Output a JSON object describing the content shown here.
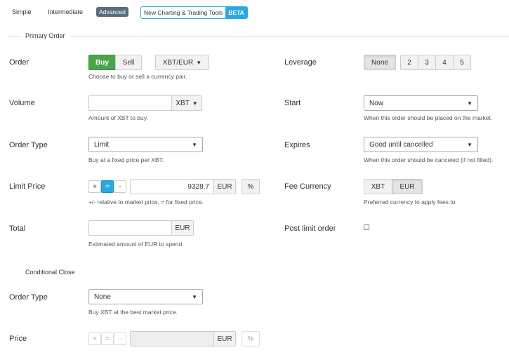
{
  "modes": {
    "simple": "Simple",
    "intermediate": "Intermediate",
    "advanced": "Advanced",
    "new_tools": "New Charting & Trading Tools",
    "beta": "BETA"
  },
  "sections": {
    "primary": "Primary Order",
    "conditional": "Conditional Close"
  },
  "order": {
    "label": "Order",
    "buy": "Buy",
    "sell": "Sell",
    "pair": "XBT/EUR",
    "help": "Choose to buy or sell a currency pair."
  },
  "volume": {
    "label": "Volume",
    "value": "",
    "unit": "XBT",
    "help": "Amount of XBT to buy."
  },
  "order_type": {
    "label": "Order Type",
    "value": "Limit",
    "help": "Buy at a fixed price per XBT."
  },
  "limit_price": {
    "label": "Limit Price",
    "plus": "+",
    "equals": "=",
    "minus": "-",
    "value": "9328.7",
    "unit": "EUR",
    "percent": "%",
    "help": "+/- relative to market price, = for fixed price."
  },
  "total": {
    "label": "Total",
    "value": "",
    "unit": "EUR",
    "help": "Estimated amount of EUR to spend."
  },
  "leverage": {
    "label": "Leverage",
    "options": [
      "None",
      "2",
      "3",
      "4",
      "5"
    ],
    "selected": "None"
  },
  "start": {
    "label": "Start",
    "value": "Now",
    "help": "When this order should be placed on the market."
  },
  "expires": {
    "label": "Expires",
    "value": "Good until cancelled",
    "help": "When this order should be canceled (if not filled)."
  },
  "fee_currency": {
    "label": "Fee Currency",
    "options": [
      "XBT",
      "EUR"
    ],
    "selected": "EUR",
    "help": "Preferred currency to apply fees to."
  },
  "post_limit": {
    "label": "Post limit order",
    "checked": false
  },
  "close_order_type": {
    "label": "Order Type",
    "value": "None",
    "help": "Buy XBT at the best market price."
  },
  "close_price": {
    "label": "Price",
    "plus": "+",
    "equals": "=",
    "minus": "-",
    "value": "",
    "unit": "EUR",
    "percent": "%"
  }
}
